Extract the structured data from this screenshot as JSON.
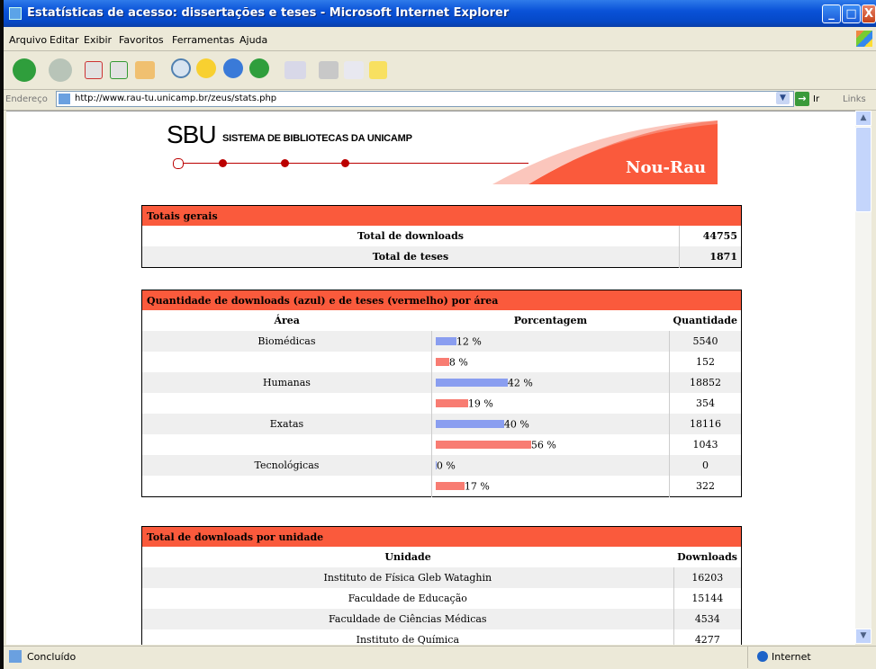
{
  "window": {
    "title": "Estatísticas de acesso: dissertações e teses - Microsoft Internet Explorer",
    "min_symbol": "_",
    "max_symbol": "□",
    "close_symbol": "X"
  },
  "menu": [
    "Arquivo",
    "Editar",
    "Exibir",
    "Favoritos",
    "Ferramentas",
    "Ajuda"
  ],
  "address": {
    "label": "Endereço",
    "url": "http://www.rau-tu.unicamp.br/zeus/stats.php",
    "go": "Ir",
    "links": "Links"
  },
  "status": {
    "text": "Concluído",
    "zone": "Internet"
  },
  "banner": {
    "logo": "SBU",
    "subtitle": "SISTEMA DE BIBLIOTECAS DA UNICAMP",
    "brand": "Nou-Rau"
  },
  "totals": {
    "heading": "Totais gerais",
    "rows": [
      {
        "label": "Total de downloads",
        "value": "44755"
      },
      {
        "label": "Total de teses",
        "value": "1871"
      }
    ]
  },
  "by_area": {
    "heading": "Quantidade de downloads (azul) e de teses (vermelho) por área",
    "col_area": "Área",
    "col_pct": "Porcentagem",
    "col_qty": "Quantidade",
    "rows": [
      {
        "area": "Biomédicas",
        "pct": "12 %",
        "pct_value": 12,
        "kind": "blue",
        "qty": "5540"
      },
      {
        "area": "",
        "pct": "8 %",
        "pct_value": 8,
        "kind": "red",
        "qty": "152"
      },
      {
        "area": "Humanas",
        "pct": "42 %",
        "pct_value": 42,
        "kind": "blue",
        "qty": "18852"
      },
      {
        "area": "",
        "pct": "19 %",
        "pct_value": 19,
        "kind": "red",
        "qty": "354"
      },
      {
        "area": "Exatas",
        "pct": "40 %",
        "pct_value": 40,
        "kind": "blue",
        "qty": "18116"
      },
      {
        "area": "",
        "pct": "56 %",
        "pct_value": 56,
        "kind": "red",
        "qty": "1043"
      },
      {
        "area": "Tecnológicas",
        "pct": "0 %",
        "pct_value": 0,
        "kind": "blue",
        "qty": "0"
      },
      {
        "area": "",
        "pct": "17 %",
        "pct_value": 17,
        "kind": "red",
        "qty": "322"
      }
    ]
  },
  "by_unit": {
    "heading": "Total de downloads por unidade",
    "col_unit": "Unidade",
    "col_dl": "Downloads",
    "rows": [
      {
        "unit": "Instituto de Física Gleb Wataghin",
        "dl": "16203"
      },
      {
        "unit": "Faculdade de Educação",
        "dl": "15144"
      },
      {
        "unit": "Faculdade de Ciências Médicas",
        "dl": "4534"
      },
      {
        "unit": "Instituto de Química",
        "dl": "4277"
      }
    ]
  },
  "colors": {
    "header": "#fa5a3c",
    "blue_bar": "#8a9ef0",
    "red_bar": "#f87c72",
    "title_bar": "#0a52d8"
  }
}
